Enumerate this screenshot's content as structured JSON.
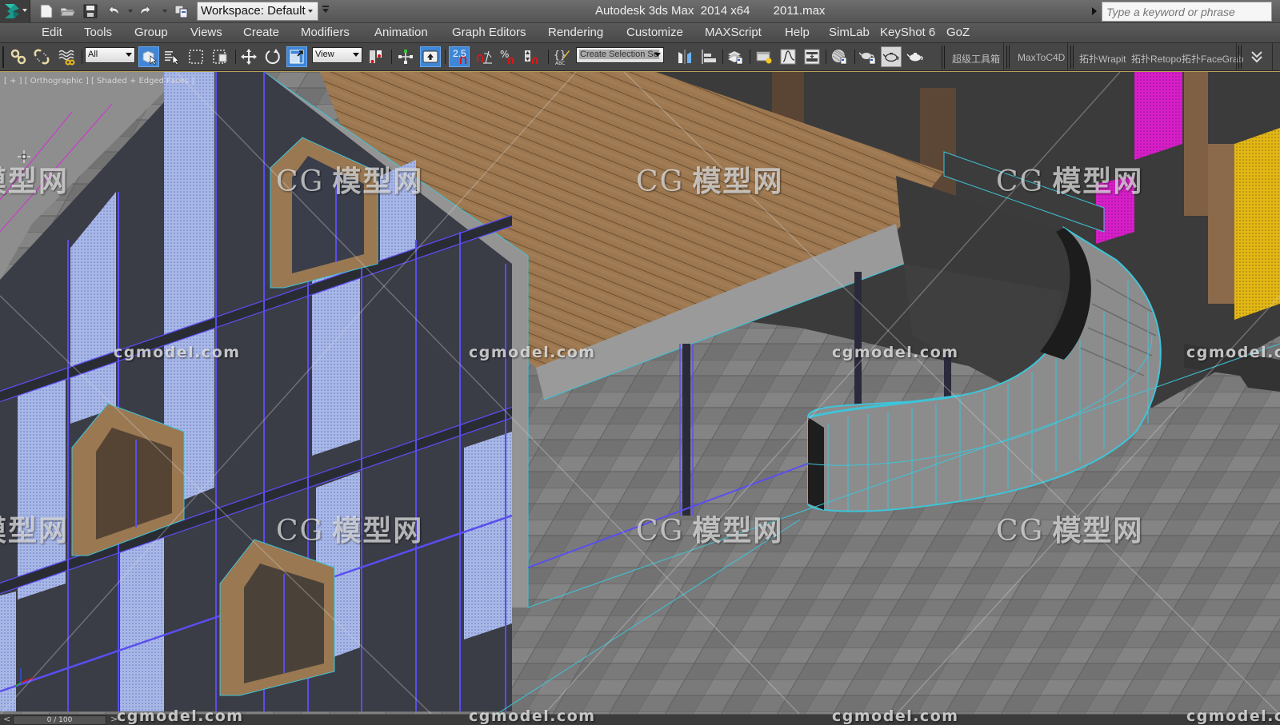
{
  "titlebar": {
    "app_name": "Autodesk 3ds Max  2014 x64",
    "file_name": "2011.max",
    "workspace_label": "Workspace: Default",
    "search_placeholder": "Type a keyword or phrase",
    "quick_access": [
      "new-file",
      "open-file",
      "save-file",
      "undo",
      "redo",
      "project-folder"
    ]
  },
  "menubar": {
    "items": [
      "Edit",
      "Tools",
      "Group",
      "Views",
      "Create",
      "Modifiers",
      "Animation",
      "Graph Editors",
      "Rendering",
      "Customize",
      "MAXScript",
      "Help",
      "SimLab",
      "KeyShot 6",
      "GoZ"
    ]
  },
  "toolbar": {
    "selection_filter": "All",
    "reference_coord": "View",
    "snap_value": "2.5",
    "named_selection_placeholder": "Create Selection Se",
    "plugin_buttons": {
      "toolbox": "超级工具箱",
      "max_to_c4d": "MaxToC4D",
      "wrapit": "拓扑Wrapit",
      "retopo": "拓扑Retopo",
      "facegrab": "拓扑FaceGrab"
    }
  },
  "viewport": {
    "label": "[ + ] [ Orthographic ] [ Shaded + Edged Faces ]",
    "watermark_cn": "模型网",
    "watermark_logo": "CG",
    "watermark_en": "cgmodel.com",
    "colors": {
      "wireframe_cyan": "#3ec4d8",
      "wireframe_blue": "#5a4ef0",
      "wireframe_magenta": "#c83cc8",
      "wood": "#9a7550",
      "concrete": "#8a8a8a",
      "perforated_panel": "#a8b8e8",
      "magenta_panel": "#d020c8",
      "yellow_panel": "#e2b814",
      "selection_border": "#b8a15a"
    }
  },
  "timeline": {
    "prev_label": "<",
    "frame_display": "0 / 100",
    "next_label": ">"
  }
}
